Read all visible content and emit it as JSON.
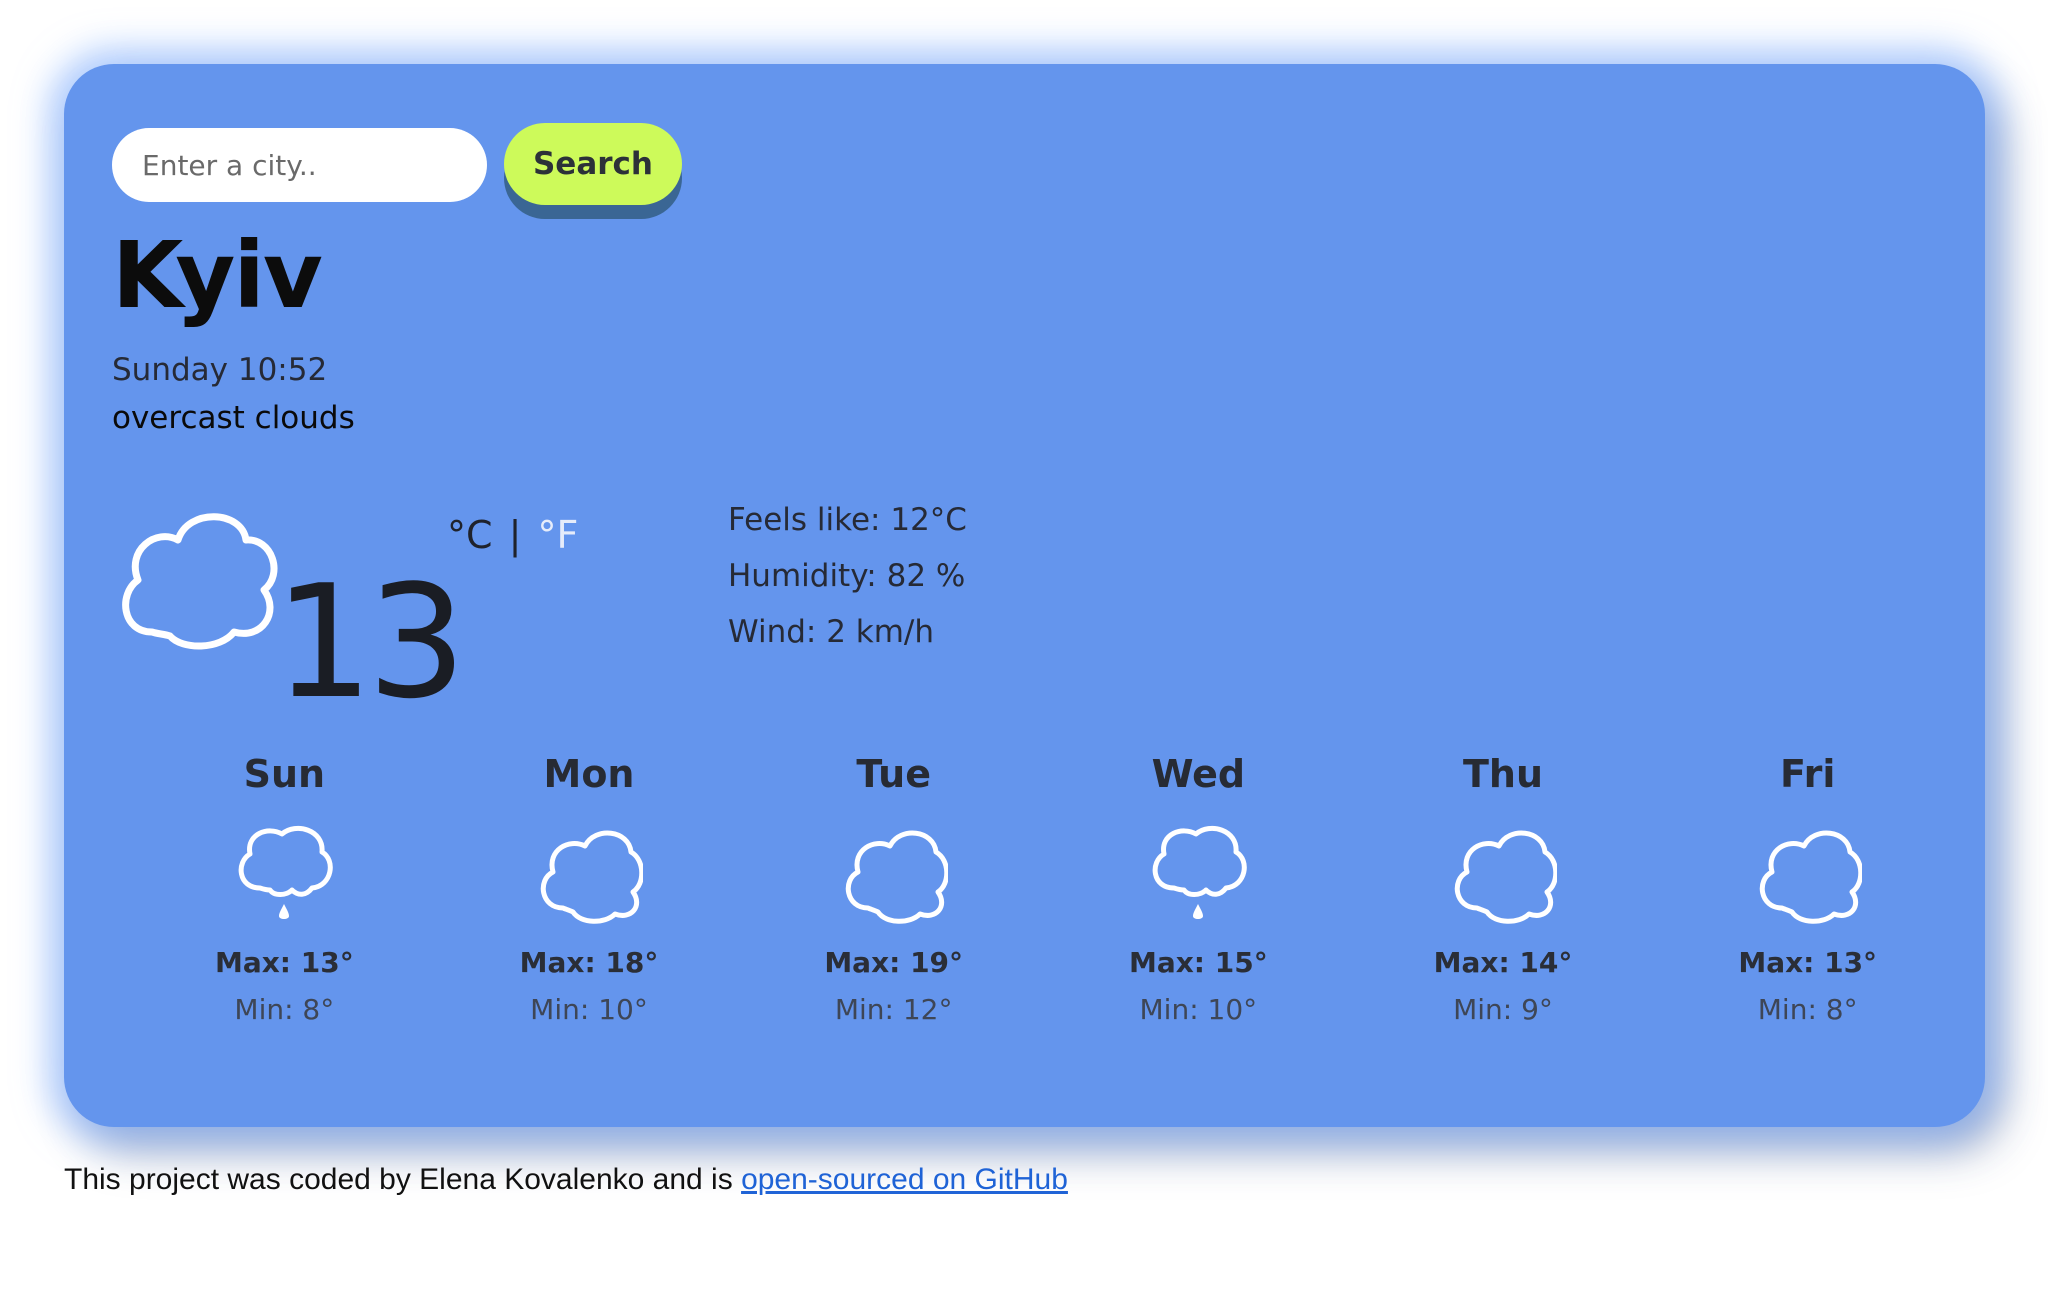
{
  "search": {
    "placeholder": "Enter a city..",
    "value": "",
    "button_label": "Search"
  },
  "current": {
    "city": "Kyiv",
    "datetime": "Sunday 10:52",
    "description": "overcast clouds",
    "icon": "cloud-icon",
    "temperature": "13",
    "unit_celsius": "°C",
    "unit_separator": "|",
    "unit_fahrenheit": "°F",
    "details": {
      "feels_like": "Feels like: 12°C",
      "humidity": "Humidity: 82 %",
      "wind": "Wind: 2 km/h"
    }
  },
  "forecast": [
    {
      "day": "Sun",
      "icon": "cloud-rain-icon",
      "max": "Max: 13°",
      "min": "Min: 8°"
    },
    {
      "day": "Mon",
      "icon": "cloud-icon",
      "max": "Max: 18°",
      "min": "Min: 10°"
    },
    {
      "day": "Tue",
      "icon": "cloud-icon",
      "max": "Max: 19°",
      "min": "Min: 12°"
    },
    {
      "day": "Wed",
      "icon": "cloud-rain-icon",
      "max": "Max: 15°",
      "min": "Min: 10°"
    },
    {
      "day": "Thu",
      "icon": "cloud-icon",
      "max": "Max: 14°",
      "min": "Min: 9°"
    },
    {
      "day": "Fri",
      "icon": "cloud-icon",
      "max": "Max: 13°",
      "min": "Min: 8°"
    }
  ],
  "footer": {
    "text": "This project was coded by Elena Kovalenko and is ",
    "link_text": "open-sourced on GitHub"
  },
  "colors": {
    "card_background": "#6495ed",
    "search_button": "#cdfa5a",
    "link": "#1f63d6"
  }
}
